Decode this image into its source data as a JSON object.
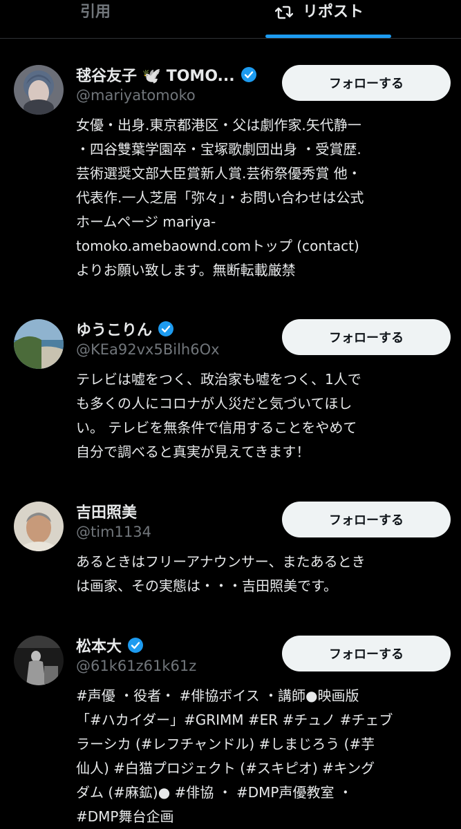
{
  "tabs": {
    "quote": "引用",
    "repost": "リポスト"
  },
  "users": [
    {
      "name": "毬谷友子 🕊️ TOMO...",
      "handle": "@mariyatomoko",
      "follow": "フォローする",
      "bio": "女優・出身.東京都港区・父は劇作家.矢代静一\n・四谷雙葉学園卒・宝塚歌劇団出身 ・受賞歴.\n芸術選奨文部大臣賞新人賞.芸術祭優秀賞 他・\n代表作.一人芝居「弥々」・お問い合わせは公式\nホームページ mariya-\ntomoko.amebaownd.comトップ (contact)\nよりお願い致します。無断転載厳禁"
    },
    {
      "name": "ゆうこりん",
      "handle": "@KEa92vx5Bilh6Ox",
      "follow": "フォローする",
      "bio": "テレビは嘘をつく、政治家も嘘をつく、1人で\nも多くの人にコロナが人災だと気づいてほし\nい。 テレビを無条件で信用することをやめて\n自分で調べると真実が見えてきます！"
    },
    {
      "name": "吉田照美",
      "handle": "@tim1134",
      "follow": "フォローする",
      "bio": "あるときはフリーアナウンサー、またあるとき\nは画家、その実態は・・・吉田照美です。"
    },
    {
      "name": "松本大",
      "handle": "@61k61z61k61z",
      "follow": "フォローする",
      "bio": "#声優 ・役者・ #俳協ボイス ・講師●映画版\n「#ハカイダー」#GRIMM #ER #チュノ #チェブ\nラーシカ (#レフチャンドル) #しまじろう (#芋\n仙人) #白猫プロジェクト (#スキピオ) #キング\nダム (#麻鉱)● #俳協 ・ #DMP声優教室 ・\n#DMP舞台企画"
    }
  ]
}
